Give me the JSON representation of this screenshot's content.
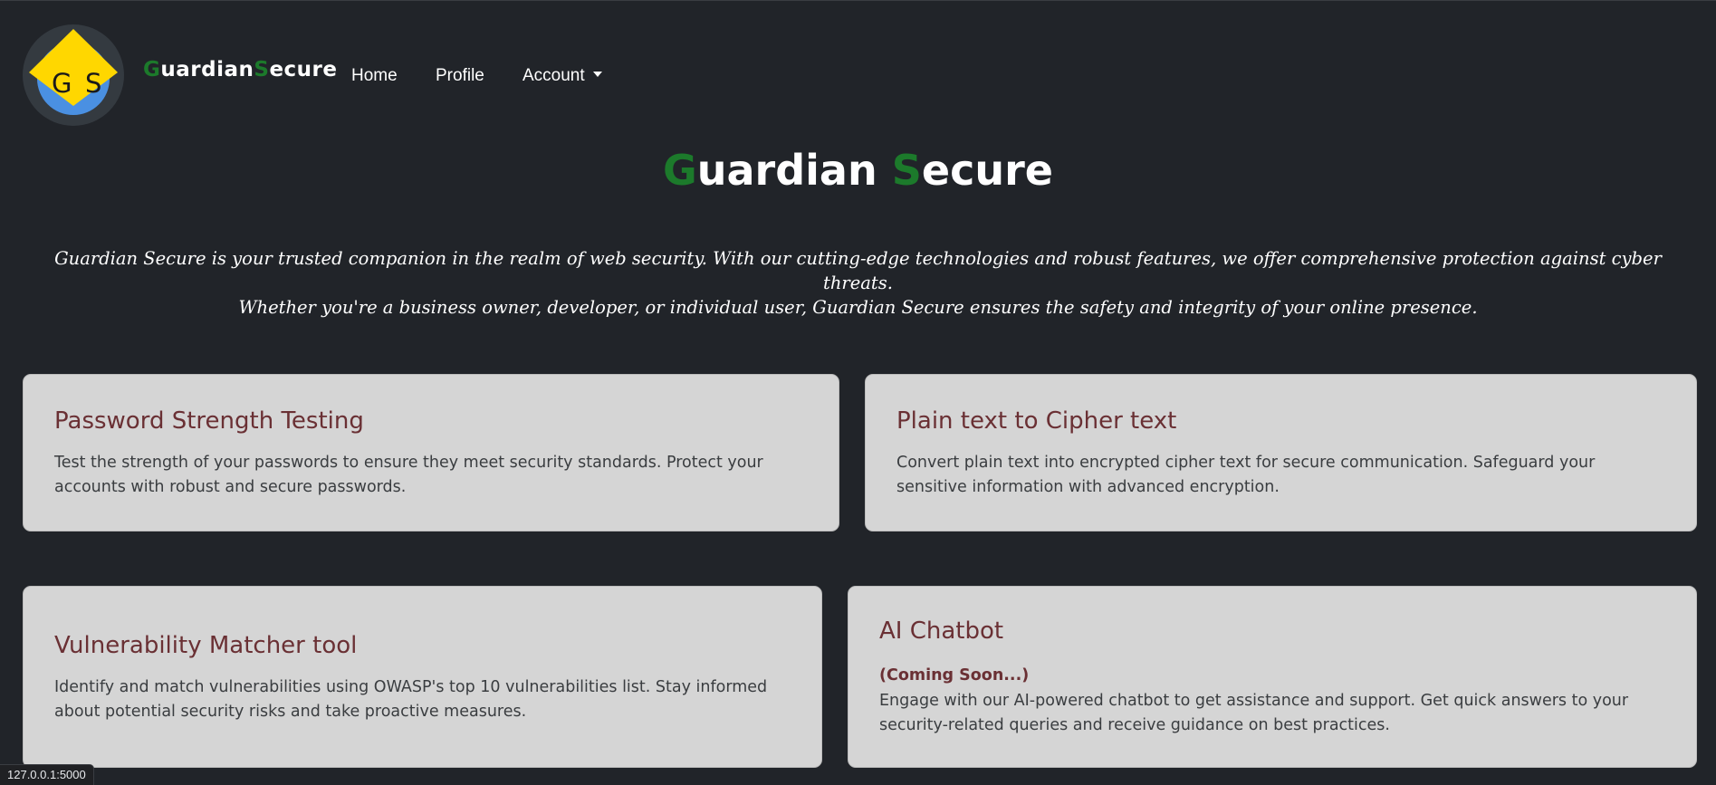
{
  "navbar": {
    "logo_letters": [
      "G",
      "S"
    ],
    "brand_first_letter": "G",
    "brand_first_rest": "uardian",
    "brand_second_letter": "S",
    "brand_second_rest": "ecure",
    "links": {
      "home": "Home",
      "profile": "Profile",
      "account": "Account"
    }
  },
  "hero": {
    "title_first_letter": "G",
    "title_first_rest": "uardian",
    "title_second_letter": "S",
    "title_second_rest": "ecure",
    "line1": "Guardian Secure is your trusted companion in the realm of web security. With our cutting-edge technologies and robust features, we offer comprehensive protection against cyber threats.",
    "line2": "Whether you're a business owner, developer, or individual user, Guardian Secure ensures the safety and integrity of your online presence."
  },
  "cards": [
    {
      "title": "Password Strength Testing",
      "text": "Test the strength of your passwords to ensure they meet security standards. Protect your accounts with robust and secure passwords."
    },
    {
      "title": "Plain text to Cipher text",
      "text": "Convert plain text into encrypted cipher text for secure communication. Safeguard your sensitive information with advanced encryption."
    },
    {
      "title": "Vulnerability Matcher tool",
      "text": "Identify and match vulnerabilities using OWASP's top 10 vulnerabilities list. Stay informed about potential security risks and take proactive measures."
    },
    {
      "title": "AI Chatbot",
      "subtitle": "(Coming Soon...)",
      "text": "Engage with our AI-powered chatbot to get assistance and support. Get quick answers to your security-related queries and receive guidance on best practices."
    }
  ],
  "status_bar": {
    "url": "127.0.0.1:5000"
  },
  "colors": {
    "background": "#212429",
    "brand_accent": "#1c7a2b",
    "card_background": "#d5d5d5",
    "card_title": "#6a3034",
    "logo_diamond": "#ffd700",
    "logo_ring": "#4a90e2"
  }
}
